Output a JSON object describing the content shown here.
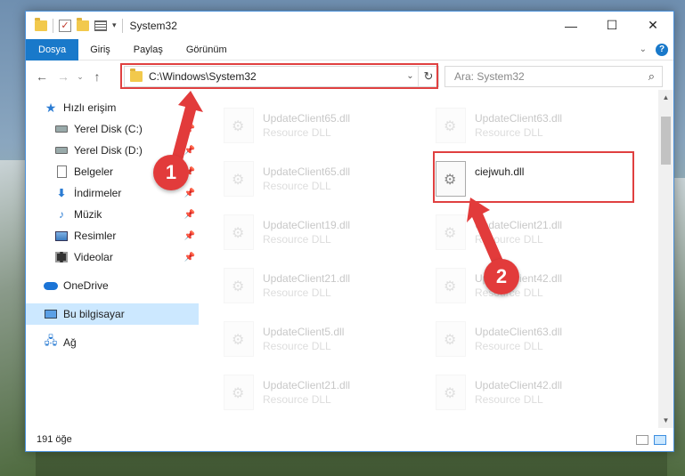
{
  "window": {
    "title": "System32",
    "controls": {
      "minimize": "—",
      "maximize": "☐",
      "close": "✕"
    }
  },
  "ribbon": {
    "tabs": [
      "Dosya",
      "Giriş",
      "Paylaş",
      "Görünüm"
    ],
    "help": "?"
  },
  "nav": {
    "back": "←",
    "forward": "→",
    "recent": "⌄",
    "up": "↑",
    "address": "C:\\Windows\\System32",
    "address_dropdown": "⌄",
    "refresh": "↻",
    "search_placeholder": "Ara: System32",
    "search_icon": "⌕"
  },
  "sidebar": {
    "items": [
      {
        "label": "Hızlı erişim",
        "icon": "star-icon",
        "sub": false,
        "pinned": false
      },
      {
        "label": "Yerel Disk (C:)",
        "icon": "drive-icon",
        "sub": true,
        "pinned": true
      },
      {
        "label": "Yerel Disk (D:)",
        "icon": "drive-icon",
        "sub": true,
        "pinned": true
      },
      {
        "label": "Belgeler",
        "icon": "document-icon",
        "sub": true,
        "pinned": true
      },
      {
        "label": "İndirmeler",
        "icon": "download-icon",
        "sub": true,
        "pinned": true
      },
      {
        "label": "Müzik",
        "icon": "music-icon",
        "sub": true,
        "pinned": true
      },
      {
        "label": "Resimler",
        "icon": "pictures-icon",
        "sub": true,
        "pinned": true
      },
      {
        "label": "Videolar",
        "icon": "video-icon",
        "sub": true,
        "pinned": true
      },
      {
        "label": "OneDrive",
        "icon": "cloud-icon",
        "sub": false,
        "pinned": false
      },
      {
        "label": "Bu bilgisayar",
        "icon": "computer-icon",
        "sub": false,
        "pinned": false,
        "selected": true
      },
      {
        "label": "Ağ",
        "icon": "network-icon",
        "sub": false,
        "pinned": false
      }
    ],
    "pin_glyph": "📌"
  },
  "files": {
    "left_column": [
      {
        "name": "UpdateClient65.dll",
        "type": "Resource DLL"
      },
      {
        "name": "UpdateClient65.dll",
        "type": "Resource DLL"
      },
      {
        "name": "UpdateClient19.dll",
        "type": "Resource DLL"
      },
      {
        "name": "UpdateClient21.dll",
        "type": "Resource DLL"
      },
      {
        "name": "UpdateClient5.dll",
        "type": "Resource DLL"
      },
      {
        "name": "UpdateClient21.dll",
        "type": "Resource DLL"
      }
    ],
    "right_column": [
      {
        "name": "UpdateClient63.dll",
        "type": "Resource DLL"
      },
      {
        "name": "ciejwuh.dll",
        "type": "",
        "focus": true
      },
      {
        "name": "UpdateClient21.dll",
        "type": "Resource DLL"
      },
      {
        "name": "UpdateClient42.dll",
        "type": "Resource DLL"
      },
      {
        "name": "UpdateClient63.dll",
        "type": "Resource DLL"
      },
      {
        "name": "UpdateClient42.dll",
        "type": "Resource DLL"
      }
    ]
  },
  "status": {
    "count": "191 öğe"
  },
  "annotations": {
    "badge1": "1",
    "badge2": "2",
    "color": "#e23b3b"
  }
}
